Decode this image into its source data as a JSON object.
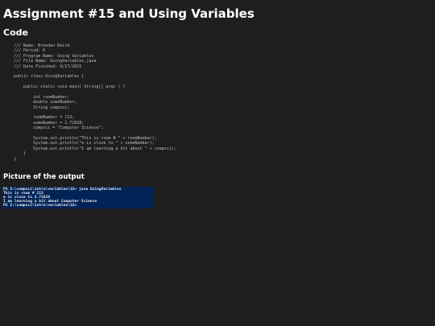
{
  "page": {
    "title": "Assignment #15 and Using Variables",
    "code_heading": "Code",
    "output_heading": "Picture of the output"
  },
  "code": {
    "lines": [
      "/// Name: Brendan Baird",
      "/// Period: 6",
      "/// Program Name: Using Variables",
      "/// File Name: UsingVariables.java",
      "/// Date Finished: 9/17/2015",
      "",
      "public class UsingVariables {",
      "",
      "    public static void main( String[] args ) {",
      "",
      "        int roomNumber;",
      "        double someNumber;",
      "        String compsci;",
      "",
      "        roomNumber = 113;",
      "        someNumber = 2.71828;",
      "        compsci = \"Computer Science\";",
      "",
      "        System.out.println(\"This is room # \" + roomNumber);",
      "        System.out.println(\"e is close to \" + someNumber);",
      "        System.out.println(\"I am learning a bit about \" + compsci);",
      "    }",
      "}"
    ]
  },
  "console": {
    "background": "#012456",
    "lines": [
      "PS Z:\\compsci\\intro\\variables\\15> java UsingVariables",
      "This is room # 113",
      "e is close to 2.71828",
      "I am learning a bit about Computer Science",
      "PS Z:\\compsci\\intro\\variables\\15>"
    ]
  }
}
